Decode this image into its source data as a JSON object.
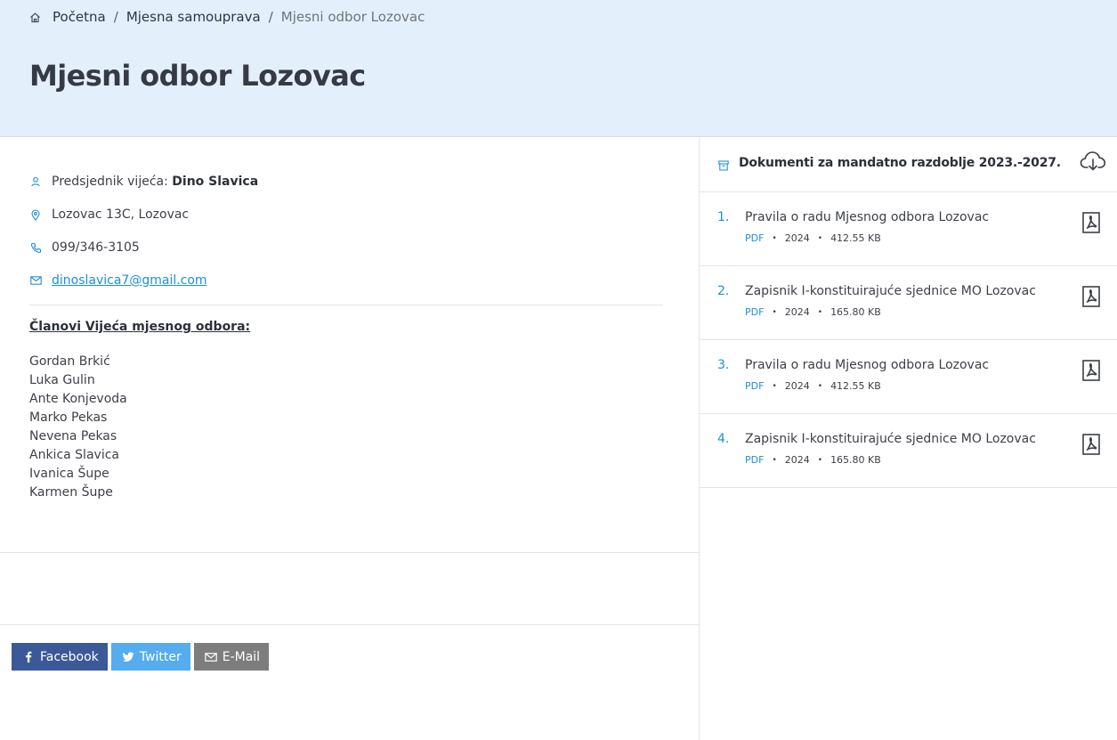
{
  "breadcrumb": {
    "home_icon": "home-icon",
    "items": [
      "Početna",
      "Mjesna samouprava"
    ],
    "separator": "/",
    "current": "Mjesni odbor Lozovac"
  },
  "page": {
    "title": "Mjesni odbor Lozovac"
  },
  "contact": {
    "president_label": "Predsjednik vijeća:",
    "president_name": "Dino Slavica",
    "address": "Lozovac 13C, Lozovac",
    "phone": "099/346-3105",
    "email": "dinoslavica7@gmail.com",
    "icons": [
      "user-icon",
      "map-pin-icon",
      "phone-icon",
      "mail-icon"
    ]
  },
  "members": {
    "title": "Članovi Vijeća mjesnog odbora:",
    "names": [
      "Gordan Brkić",
      "Luka Gulin",
      "Ante Konjevoda",
      "Marko Pekas",
      "Nevena Pekas",
      "Ankica Slavica",
      "Ivanica Šupe",
      "Karmen Šupe"
    ]
  },
  "share": {
    "facebook": "Facebook",
    "twitter": "Twitter",
    "email": "E-Mail",
    "colors": {
      "facebook": "#3b5998",
      "twitter": "#55acee",
      "email": "#7d7d7d"
    }
  },
  "documents": {
    "title": "Dokumenti za mandatno razdoblje 2023.-2027.",
    "items": [
      {
        "num": "1.",
        "title": "Pravila o radu Mjesnog odbora Lozovac",
        "type": "PDF",
        "year": "2024",
        "size": "412.55 KB"
      },
      {
        "num": "2.",
        "title": "Zapisnik I-konstituirajuće sjednice MO Lozovac",
        "type": "PDF",
        "year": "2024",
        "size": "165.80 KB"
      },
      {
        "num": "3.",
        "title": "Pravila o radu Mjesnog odbora Lozovac",
        "type": "PDF",
        "year": "2024",
        "size": "412.55 KB"
      },
      {
        "num": "4.",
        "title": "Zapisnik I-konstituirajuće sjednice MO Lozovac",
        "type": "PDF",
        "year": "2024",
        "size": "165.80 KB"
      }
    ]
  },
  "colors": {
    "accent": "#1d8fd8",
    "hero_bg": "#e3f0fb",
    "text": "#3d4047"
  }
}
